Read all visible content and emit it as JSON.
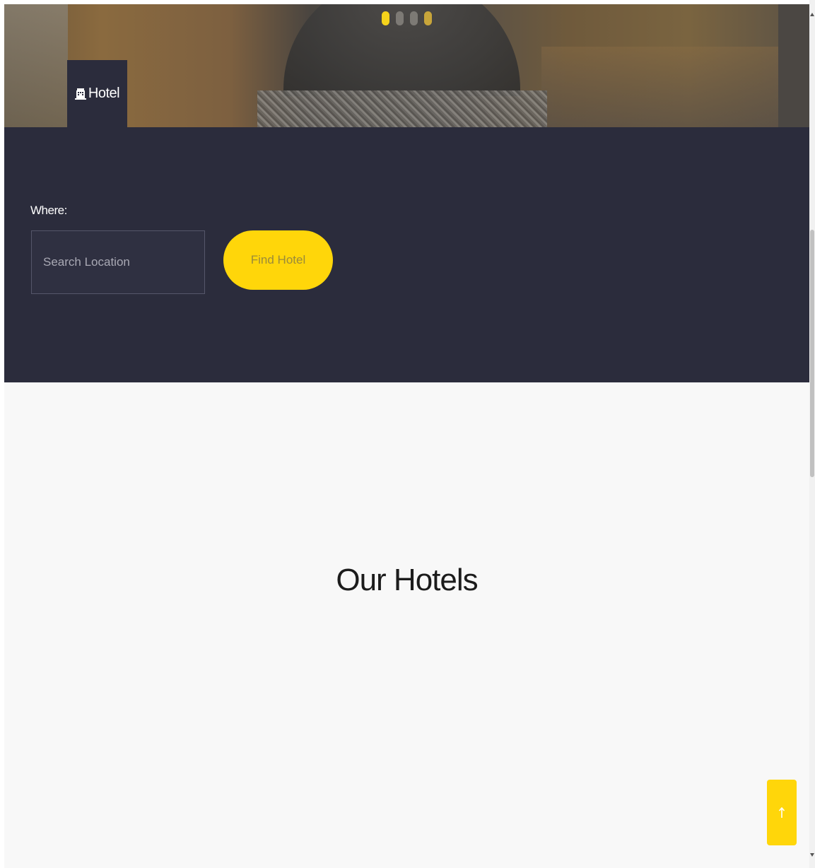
{
  "hero": {
    "slide_count": 4,
    "active_slide": 1,
    "tab": {
      "label": "Hotel",
      "icon": "hotel-building-icon"
    }
  },
  "search": {
    "where_label": "Where:",
    "location_placeholder": "Search Location",
    "location_value": "",
    "submit_label": "Find Hotel"
  },
  "content": {
    "section_title": "Our Hotels"
  },
  "scroll_top": {
    "icon": "arrow-up-icon"
  },
  "colors": {
    "accent": "#ffd60a",
    "panel": "#2b2c3c",
    "background": "#f8f8f8"
  }
}
